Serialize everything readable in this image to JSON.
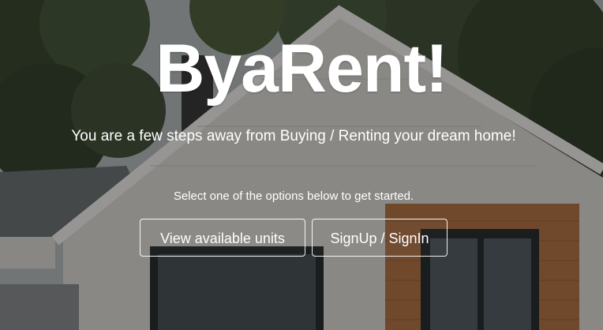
{
  "hero": {
    "brand_title": "ByaRent!",
    "tagline": "You are a few steps away from Buying / Renting your dream home!",
    "hint": "Select one of the options below to get started."
  },
  "actions": {
    "view_units_label": "View available units",
    "signup_label": "SignUp / SignIn"
  },
  "colors": {
    "text": "#ffffff",
    "overlay": "rgba(0,0,0,0.38)",
    "button_border": "#ffffff"
  }
}
